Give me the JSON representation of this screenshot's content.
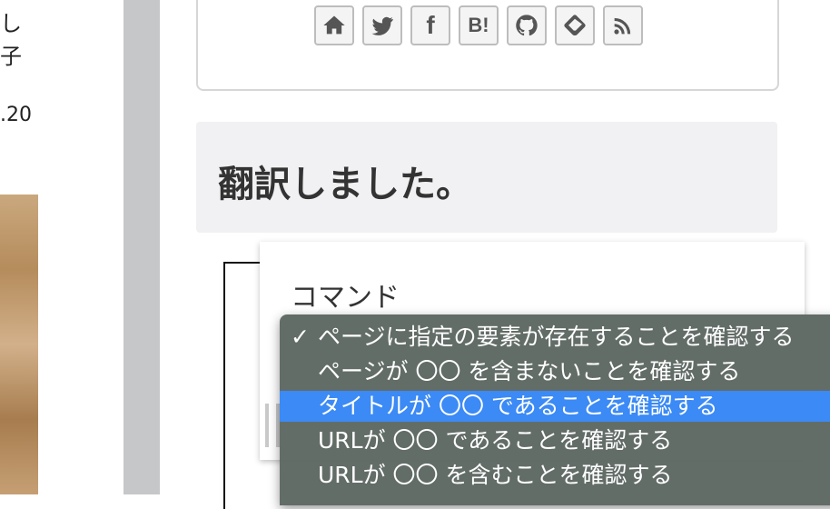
{
  "left_fragment": {
    "line1": "し",
    "line2": "子",
    "date_fragment": ".20"
  },
  "share_icons": [
    "home-icon",
    "twitter-icon",
    "facebook-icon",
    "hatena-bookmark-icon",
    "github-icon",
    "feedly-icon",
    "rss-icon"
  ],
  "hatena_label": "B!",
  "facebook_label": "f",
  "article_title": "翻訳しました。",
  "command_label": "コマンド",
  "dropdown": {
    "check": "✓",
    "options": [
      "ページに指定の要素が存在することを確認する",
      "ページが 〇〇 を含まないことを確認する",
      "タイトルが 〇〇 であることを確認する",
      "URLが 〇〇 であることを確認する",
      "URLが 〇〇 を含むことを確認する"
    ],
    "checked_index": 0,
    "highlighted_index": 2
  },
  "colors": {
    "gutter": "#c6c7c9",
    "title_bg": "#f1f1f3",
    "dropdown_bg": "#5e6863",
    "highlight": "#3b8af5"
  }
}
